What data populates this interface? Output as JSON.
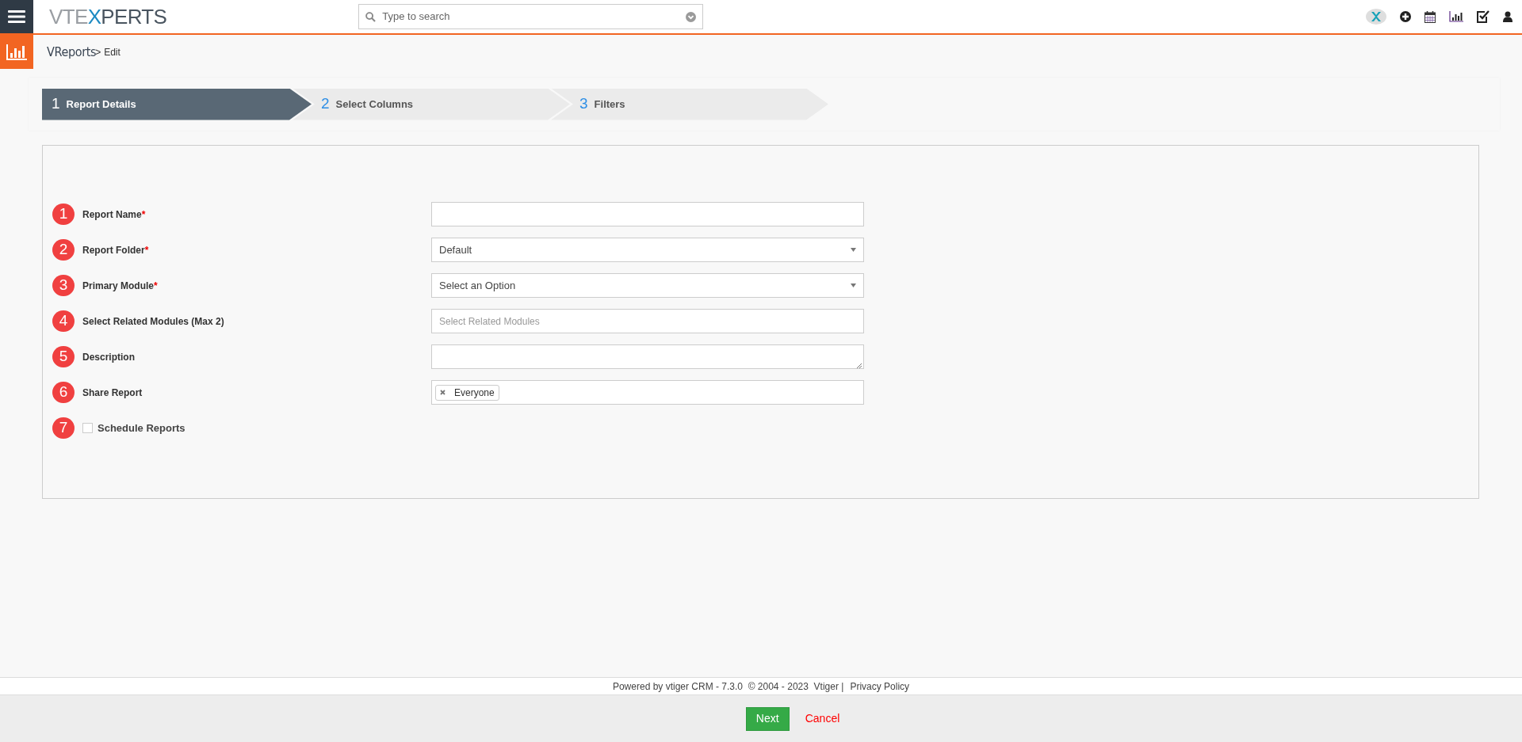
{
  "header": {
    "logo": [
      {
        "text": "VTE",
        "color": "#9a9ea3"
      },
      {
        "text": "X",
        "color": "#1e8bc3"
      },
      {
        "text": "PERTS",
        "color": "#4a5560"
      }
    ],
    "search": {
      "placeholder": "Type to search"
    }
  },
  "breadcrumb": {
    "module": "VReports",
    "separator": ">",
    "page": "Edit"
  },
  "steps": [
    {
      "number": "1",
      "label": "Report Details",
      "selected": true
    },
    {
      "number": "2",
      "label": "Select Columns",
      "selected": false
    },
    {
      "number": "3",
      "label": "Filters",
      "selected": false
    }
  ],
  "form": [
    {
      "badge": "1",
      "label": "Report Name",
      "required_mark": "*",
      "kind": "text"
    },
    {
      "badge": "2",
      "label": "Report Folder",
      "required_mark": "*",
      "kind": "select",
      "value": "Default"
    },
    {
      "badge": "3",
      "label": "Primary Module",
      "required_mark": "*",
      "kind": "select",
      "value": "Select an Option"
    },
    {
      "badge": "4",
      "label": "Select Related Modules (Max 2)",
      "kind": "multiselect",
      "placeholder": "Select Related Modules"
    },
    {
      "badge": "5",
      "label": "Description",
      "kind": "textarea"
    },
    {
      "badge": "6",
      "label": "Share Report",
      "kind": "tags",
      "tags": [
        "Everyone"
      ]
    },
    {
      "badge": "7",
      "label": "Schedule Reports",
      "kind": "checkbox",
      "checked": false
    }
  ],
  "footer": {
    "text": "Powered by vtiger CRM - 7.3.0  © 2004 - 2023  Vtiger |",
    "link": "Privacy Policy"
  },
  "actions": {
    "primary": "Next",
    "cancel": "Cancel"
  }
}
